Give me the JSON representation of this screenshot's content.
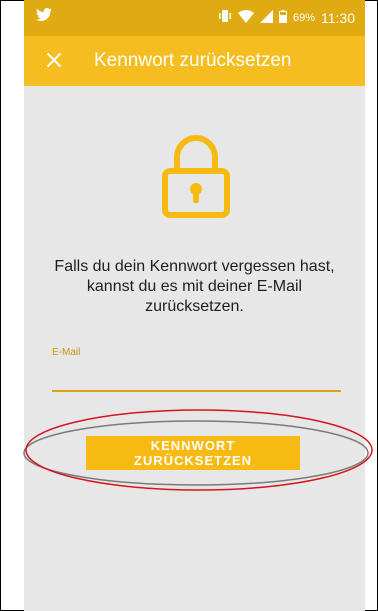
{
  "status_bar": {
    "left_icon": "twitter-bird-icon",
    "battery": "69",
    "battery_unit": "%",
    "time": "11:30"
  },
  "app_bar": {
    "close_icon": "close-icon",
    "title": "Kennwort zurücksetzen"
  },
  "main": {
    "lock_icon": "lock-icon",
    "description": "Falls du dein Kennwort vergessen hast, kannst du es mit deiner E-Mail zurücksetzen.",
    "email_label": "E-Mail",
    "email_value": "",
    "reset_button_label": "KENNWORT ZURÜCKSETZEN"
  },
  "colors": {
    "status_bar": "#e0aa12",
    "app_bar": "#f5bd1f",
    "accent": "#f7ba12",
    "background": "#e7e7e7",
    "annotation_red": "#d8141b",
    "annotation_gray": "#7a7a7a"
  }
}
